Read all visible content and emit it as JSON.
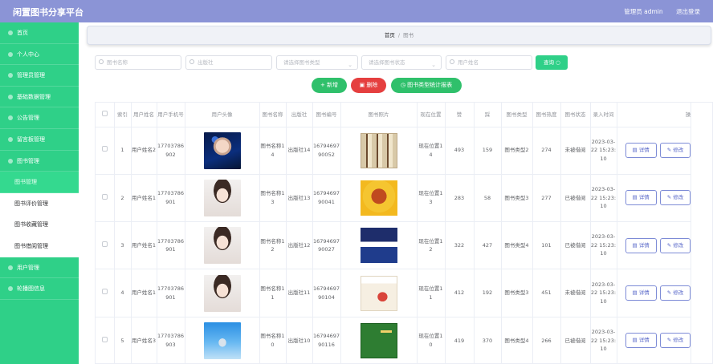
{
  "app": {
    "title": "闲置图书分享平台"
  },
  "header": {
    "user_label": "管理员 admin",
    "logout": "退出登录"
  },
  "sidebar": {
    "items": [
      {
        "label": "首页"
      },
      {
        "label": "个人中心"
      },
      {
        "label": "管理员管理"
      },
      {
        "label": "基础数据管理"
      },
      {
        "label": "公告管理"
      },
      {
        "label": "留言板管理"
      },
      {
        "label": "图书管理"
      },
      {
        "label": "图书管理"
      },
      {
        "label": "图书评价管理"
      },
      {
        "label": "图书收藏管理"
      },
      {
        "label": "图书借阅管理"
      },
      {
        "label": "用户管理"
      },
      {
        "label": "轮播图信息"
      }
    ]
  },
  "breadcrumb": {
    "home": "首页",
    "sep": "/",
    "current": "图书"
  },
  "search": {
    "book_name_ph": "图书名称",
    "publisher_ph": "出版社",
    "type_ph": "请选择图书类型",
    "status_ph": "请选择图书状态",
    "user_name_ph": "用户姓名",
    "search_btn": "查询"
  },
  "actions": {
    "add": "+ 新增",
    "delete": "删除",
    "stats": "图书类型统计报表"
  },
  "table": {
    "headers": [
      "索引",
      "用户姓名",
      "用户手机号",
      "用户头像",
      "图书名称",
      "出版社",
      "图书编号",
      "图书照片",
      "现在位置",
      "赞",
      "踩",
      "图书类型",
      "图书热度",
      "图书状态",
      "录入时间",
      "操"
    ],
    "rows": [
      {
        "index": "1",
        "user_name": "用户姓名2",
        "phone": "17703786902",
        "book_name": "图书名称14",
        "publisher": "出版社14",
        "book_no": "1679469790052",
        "location": "现在位置14",
        "like": "493",
        "dislike": "159",
        "type": "图书类型2",
        "heat": "274",
        "status": "未被借阅",
        "time": "2023-03-22 15:23:10",
        "avatar": "dark",
        "book": "box"
      },
      {
        "index": "2",
        "user_name": "用户姓名1",
        "phone": "17703786901",
        "book_name": "图书名称13",
        "publisher": "出版社13",
        "book_no": "1679469790041",
        "location": "现在位置13",
        "like": "283",
        "dislike": "58",
        "type": "图书类型3",
        "heat": "277",
        "status": "已被借阅",
        "time": "2023-03-22 15:23:10",
        "avatar": "light",
        "book": "yellow"
      },
      {
        "index": "3",
        "user_name": "用户姓名1",
        "phone": "17703786901",
        "book_name": "图书名称12",
        "publisher": "出版社12",
        "book_no": "1679469790027",
        "location": "现在位置12",
        "like": "322",
        "dislike": "427",
        "type": "图书类型4",
        "heat": "101",
        "status": "已被借阅",
        "time": "2023-03-22 15:23:10",
        "avatar": "light",
        "book": "blue"
      },
      {
        "index": "4",
        "user_name": "用户姓名1",
        "phone": "17703786901",
        "book_name": "图书名称11",
        "publisher": "出版社11",
        "book_no": "1679469790104",
        "location": "现在位置11",
        "like": "412",
        "dislike": "192",
        "type": "图书类型3",
        "heat": "451",
        "status": "未被借阅",
        "time": "2023-03-22 15:23:10",
        "avatar": "light",
        "book": "girl"
      },
      {
        "index": "5",
        "user_name": "用户姓名3",
        "phone": "17703786903",
        "book_name": "图书名称10",
        "publisher": "出版社10",
        "book_no": "1679469790116",
        "location": "现在位置10",
        "like": "419",
        "dislike": "370",
        "type": "图书类型4",
        "heat": "266",
        "status": "已被借阅",
        "time": "2023-03-22 15:23:10",
        "avatar": "sky",
        "book": "green"
      }
    ],
    "detail_btn": "详情",
    "edit_btn": "修改"
  },
  "colors": {
    "topbar": "#8b94d6",
    "sidebar": "#2fd088",
    "primary_button": "#2fc06b",
    "danger_button": "#e53f3f"
  }
}
